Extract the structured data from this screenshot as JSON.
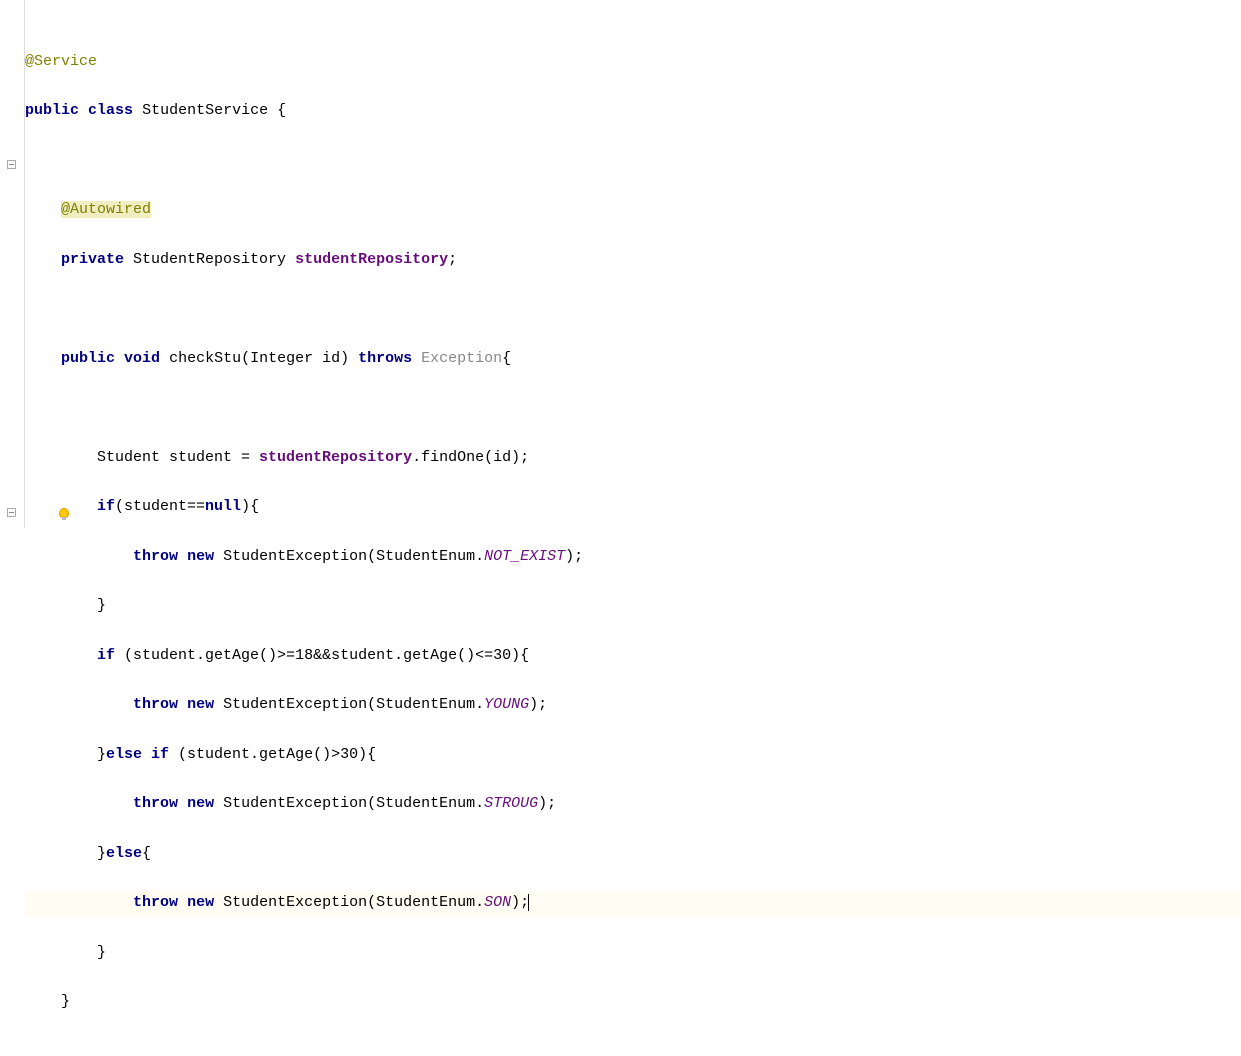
{
  "code": {
    "l1": {
      "ann": "@Service"
    },
    "l2": {
      "kw1": "public",
      "kw2": "class",
      "name": "StudentService",
      "brace": " {"
    },
    "l3": "",
    "l4": {
      "ann": "@Autowired"
    },
    "l5": {
      "kw": "private",
      "type": " StudentRepository ",
      "field": "studentRepository",
      "end": ";"
    },
    "l6": "",
    "l7": {
      "kw1": "public",
      "kw2": "void",
      "name": " checkStu",
      "params": "(Integer id) ",
      "kw3": "throws",
      "exc": " Exception",
      "brace": "{"
    },
    "l8": "",
    "l9": {
      "t1": "Student student = ",
      "field": "studentRepository",
      "t2": ".findOne(id);"
    },
    "l10": {
      "kw": "if",
      "t1": "(student==",
      "kw2": "null",
      "t2": "){"
    },
    "l11": {
      "kw1": "throw",
      "kw2": "new",
      "t1": " StudentException(StudentEnum.",
      "c": "NOT_EXIST",
      "t2": ");"
    },
    "l12": {
      "t": "}"
    },
    "l13": {
      "kw": "if",
      "t1": " (student.getAge()>=",
      "n1": "18",
      "t2": "&&student.getAge()<=",
      "n2": "30",
      "t3": "){"
    },
    "l14": {
      "kw1": "throw",
      "kw2": "new",
      "t1": " StudentException(StudentEnum.",
      "c": "YOUNG",
      "t2": ");"
    },
    "l15": {
      "t1": "}",
      "kw": "else if",
      "t2": " (student.getAge()>",
      "n": "30",
      "t3": "){"
    },
    "l16": {
      "kw1": "throw",
      "kw2": "new",
      "t1": " StudentException(StudentEnum.",
      "c": "STROUG",
      "t2": ");"
    },
    "l17": {
      "t1": "}",
      "kw": "else",
      "t2": "{"
    },
    "l18": {
      "kw1": "throw",
      "kw2": "new",
      "t1": " StudentException(StudentEnum.",
      "c": "SON",
      "t2": ");"
    },
    "l19": {
      "t": "}"
    },
    "l20": {
      "t": "}"
    }
  }
}
